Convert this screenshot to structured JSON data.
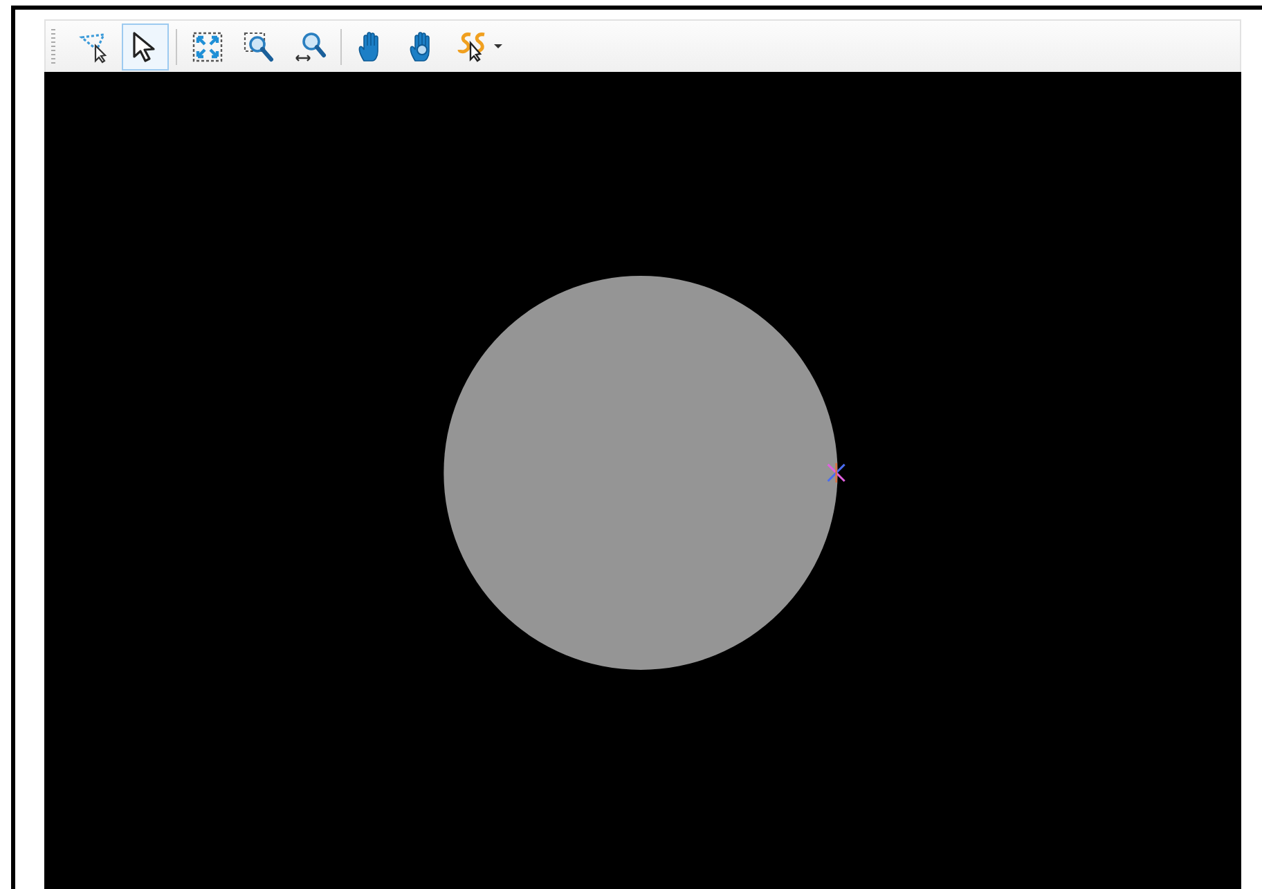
{
  "toolbar": {
    "groups": [
      {
        "tools": [
          {
            "kind": "lasso-select",
            "selected": false
          },
          {
            "kind": "select",
            "selected": true
          }
        ]
      },
      {
        "tools": [
          {
            "kind": "zoom-extents",
            "selected": false
          },
          {
            "kind": "zoom-window",
            "selected": false
          },
          {
            "kind": "zoom-pan",
            "selected": false
          }
        ]
      },
      {
        "tools": [
          {
            "kind": "pan",
            "selected": false
          },
          {
            "kind": "rotate",
            "selected": false
          },
          {
            "kind": "snap",
            "selected": false,
            "dropdown": true
          }
        ]
      }
    ]
  }
}
